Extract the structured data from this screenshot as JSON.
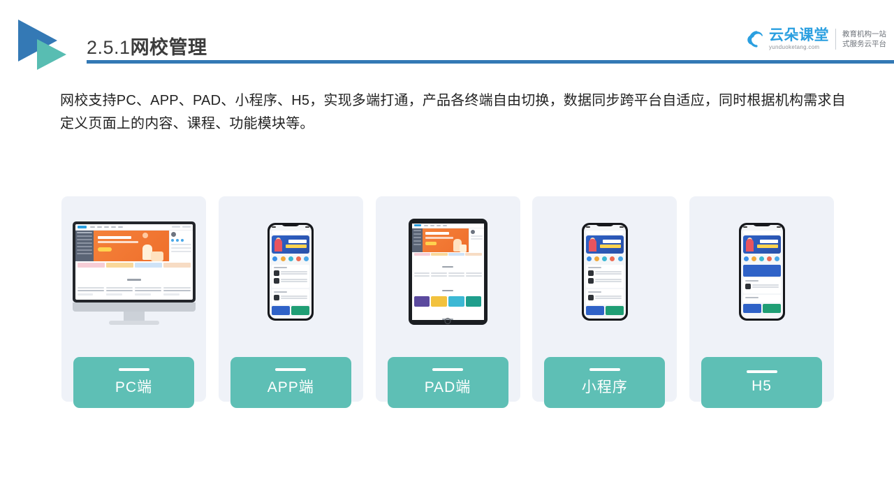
{
  "header": {
    "title_number": "2.5.1",
    "title_name": "网校管理",
    "logo_icon": "double-triangle-play-icon",
    "rule_color": "#3479b5",
    "triangle_blue": "#3479b5",
    "triangle_teal": "#58bdb2"
  },
  "brand": {
    "icon": "cloud-icon",
    "name": "云朵课堂",
    "domain": "yunduoketang.com",
    "tagline": "教育机构一站式服务云平台",
    "name_color": "#2a9fe0"
  },
  "body": {
    "paragraph": "网校支持PC、APP、PAD、小程序、H5，实现多端打通，产品各终端自由切换，数据同步跨平台自适应，同时根据机构需求自定义页面上的内容、课程、功能模块等。"
  },
  "cards": {
    "accent_color": "#5ebfb5",
    "card_bg": "#eff2f8",
    "items": [
      {
        "label": "PC端",
        "device": "desktop-monitor-mockup"
      },
      {
        "label": "APP端",
        "device": "smartphone-mockup"
      },
      {
        "label": "PAD端",
        "device": "tablet-mockup"
      },
      {
        "label": "小程序",
        "device": "smartphone-mockup"
      },
      {
        "label": "H5",
        "device": "smartphone-mockup"
      }
    ]
  }
}
